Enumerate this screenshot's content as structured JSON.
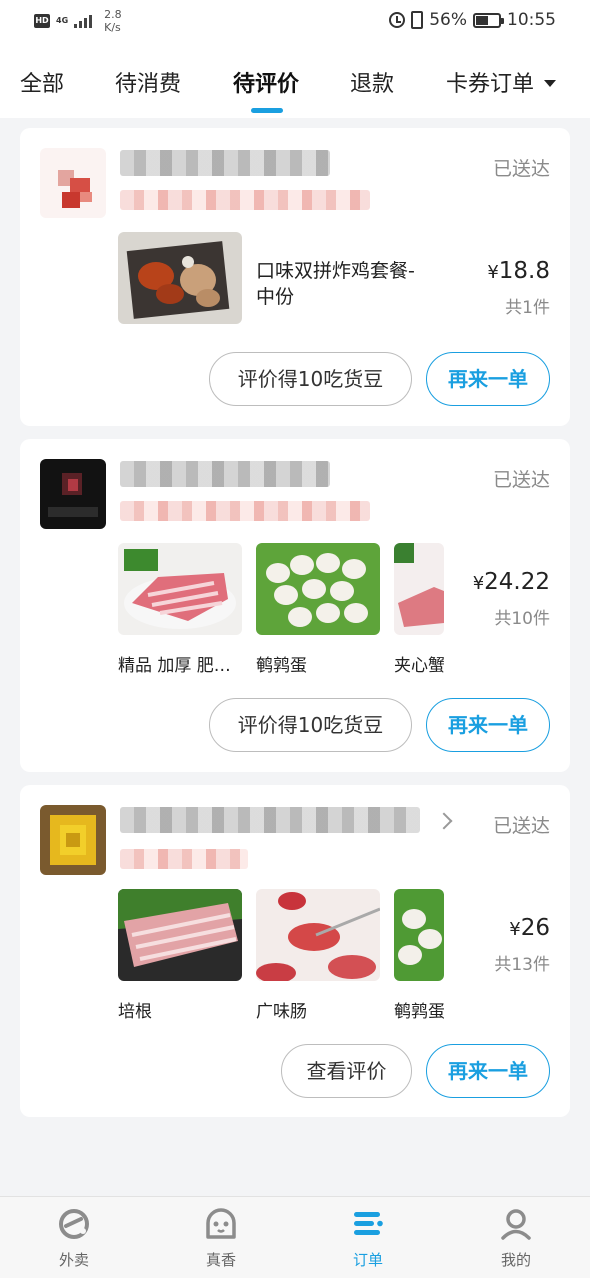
{
  "status_bar": {
    "hd": "HD",
    "net_type": "4G",
    "speed_value": "2.8",
    "speed_unit": "K/s",
    "battery_pct": "56%",
    "battery_level": 0.56,
    "time": "10:55"
  },
  "tabs": [
    {
      "label": "全部"
    },
    {
      "label": "待消费"
    },
    {
      "label": "待评价",
      "active": true
    },
    {
      "label": "退款"
    },
    {
      "label": "卡券订单"
    }
  ],
  "orders": [
    {
      "status": "已送达",
      "item_title": "口味双拼炸鸡套餐-中份",
      "price_symbol": "¥",
      "price": "18.8",
      "quantity": "共1件",
      "review_button": "评价得10吃货豆",
      "reorder_button": "再来一单"
    },
    {
      "status": "已送达",
      "items": [
        {
          "label": "精品 加厚 肥…"
        },
        {
          "label": "鹌鹑蛋"
        },
        {
          "label": "夹心蟹"
        }
      ],
      "price_symbol": "¥",
      "price": "24.22",
      "quantity": "共10件",
      "review_button": "评价得10吃货豆",
      "reorder_button": "再来一单"
    },
    {
      "status": "已送达",
      "items": [
        {
          "label": "培根"
        },
        {
          "label": "广味肠"
        },
        {
          "label": "鹌鹑蛋"
        }
      ],
      "price_symbol": "¥",
      "price": "26",
      "quantity": "共13件",
      "review_button": "查看评价",
      "reorder_button": "再来一单"
    }
  ],
  "bottom_nav": [
    {
      "label": "外卖",
      "icon": "takeout-icon"
    },
    {
      "label": "真香",
      "icon": "zhenxiang-icon"
    },
    {
      "label": "订单",
      "icon": "orders-icon",
      "active": true
    },
    {
      "label": "我的",
      "icon": "profile-icon"
    }
  ],
  "colors": {
    "accent": "#1a9fe0",
    "muted_text": "#8a8a8a",
    "background": "#f3f4f6"
  }
}
